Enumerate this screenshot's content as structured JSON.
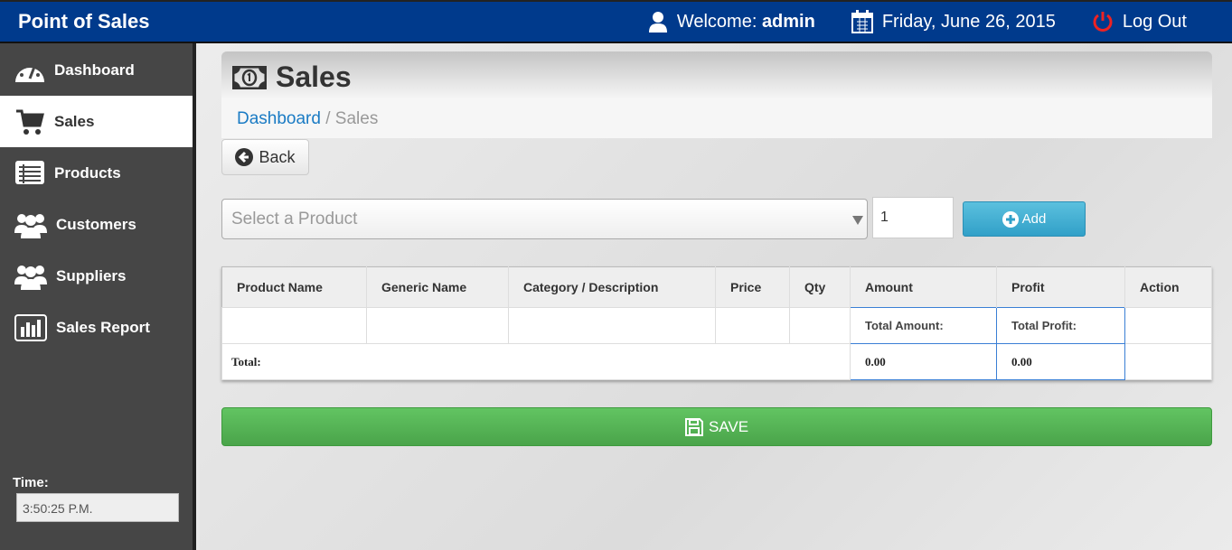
{
  "header": {
    "brand": "Point of Sales",
    "welcome_prefix": "Welcome: ",
    "user": "admin",
    "date": "Friday, June 26, 2015",
    "logout": "Log Out",
    "color": "#003a8c"
  },
  "sidebar": {
    "items": [
      {
        "label": "Dashboard",
        "icon": "dashboard-icon"
      },
      {
        "label": "Sales",
        "icon": "cart-icon",
        "active": true
      },
      {
        "label": "Products",
        "icon": "list-icon"
      },
      {
        "label": "Customers",
        "icon": "users-icon"
      },
      {
        "label": "Suppliers",
        "icon": "users-icon"
      },
      {
        "label": "Sales Report",
        "icon": "bar-chart-icon"
      }
    ],
    "time_label": "Time:",
    "time_value": "3:50:25 P.M."
  },
  "page": {
    "title": "Sales",
    "breadcrumb": {
      "home": "Dashboard",
      "sep": " / ",
      "current": "Sales"
    },
    "back": "Back"
  },
  "form": {
    "product_placeholder": "Select a Product",
    "qty": "1",
    "add": "Add"
  },
  "table": {
    "headers": [
      "Product Name",
      "Generic Name",
      "Category / Description",
      "Price",
      "Qty",
      "Amount",
      "Profit",
      "Action"
    ],
    "total_amount_label": "Total Amount:",
    "total_profit_label": "Total Profit:",
    "total_label": "Total:",
    "total_amount": "0.00",
    "total_profit": "0.00"
  },
  "save": "SAVE"
}
